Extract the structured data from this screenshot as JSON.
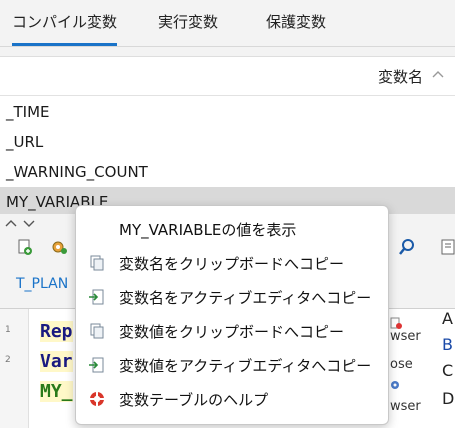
{
  "tabs": [
    {
      "label": "コンパイル変数",
      "active": true
    },
    {
      "label": "実行変数",
      "active": false
    },
    {
      "label": "保護変数",
      "active": false
    }
  ],
  "variables_table": {
    "column_header": "変数名",
    "sort_icon": "chevron-up-icon",
    "rows": [
      "_TIME",
      "_URL",
      "_WARNING_COUNT",
      "MY_VARIABLE"
    ],
    "selected_index": 3
  },
  "editor": {
    "tab_label": "T_PLAN",
    "line_numbers": [
      "1",
      "2"
    ],
    "code_lines": [
      "Rep",
      "Var",
      "MY_"
    ],
    "right_column_fragments": [
      "wser",
      "ose",
      "wser"
    ],
    "right_edge_letters": [
      "A",
      "B",
      "C",
      "D"
    ]
  },
  "context_menu": {
    "items": [
      {
        "label": "MY_VARIABLEの値を表示",
        "icon": ""
      },
      {
        "label": "変数名をクリップボードへコピー",
        "icon": "clipboard-copy-icon"
      },
      {
        "label": "変数名をアクティブエディタへコピー",
        "icon": "editor-insert-icon"
      },
      {
        "label": "変数値をクリップボードへコピー",
        "icon": "clipboard-copy-icon"
      },
      {
        "label": "変数値をアクティブエディタへコピー",
        "icon": "editor-insert-icon"
      },
      {
        "label": "変数テーブルのヘルプ",
        "icon": "help-lifebuoy-icon"
      }
    ]
  },
  "colors": {
    "accent": "#1a73c8",
    "selected_row": "#d9d9d9",
    "code_highlight": "#fff8c8"
  }
}
